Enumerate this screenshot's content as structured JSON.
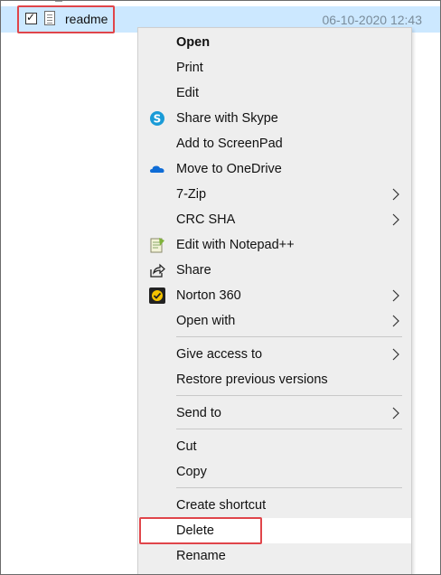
{
  "file": {
    "name": "readme",
    "date": "06-10-2020 12:43",
    "checked": true
  },
  "menu": {
    "items": [
      {
        "id": "open",
        "label": "Open",
        "bold": true
      },
      {
        "id": "print",
        "label": "Print"
      },
      {
        "id": "edit",
        "label": "Edit"
      },
      {
        "id": "share-skype",
        "label": "Share with Skype",
        "icon": "skype-icon"
      },
      {
        "id": "add-screenpad",
        "label": "Add to ScreenPad"
      },
      {
        "id": "move-onedrive",
        "label": "Move to OneDrive",
        "icon": "onedrive-icon"
      },
      {
        "id": "7zip",
        "label": "7-Zip",
        "submenu": true
      },
      {
        "id": "crc-sha",
        "label": "CRC SHA",
        "submenu": true
      },
      {
        "id": "edit-notepadpp",
        "label": "Edit with Notepad++",
        "icon": "notepadpp-icon"
      },
      {
        "id": "share",
        "label": "Share",
        "icon": "share-icon"
      },
      {
        "id": "norton",
        "label": "Norton 360",
        "icon": "norton-icon",
        "submenu": true
      },
      {
        "id": "open-with",
        "label": "Open with",
        "submenu": true
      },
      {
        "id": "give-access",
        "label": "Give access to",
        "submenu": true
      },
      {
        "id": "restore-versions",
        "label": "Restore previous versions"
      },
      {
        "id": "send-to",
        "label": "Send to",
        "submenu": true
      },
      {
        "id": "cut",
        "label": "Cut"
      },
      {
        "id": "copy",
        "label": "Copy"
      },
      {
        "id": "create-shortcut",
        "label": "Create shortcut"
      },
      {
        "id": "delete",
        "label": "Delete",
        "hovered": true
      },
      {
        "id": "rename",
        "label": "Rename"
      }
    ]
  },
  "colors": {
    "selection": "#cce8ff",
    "highlight_box": "#e0454a",
    "menu_bg": "#eeeeee"
  }
}
